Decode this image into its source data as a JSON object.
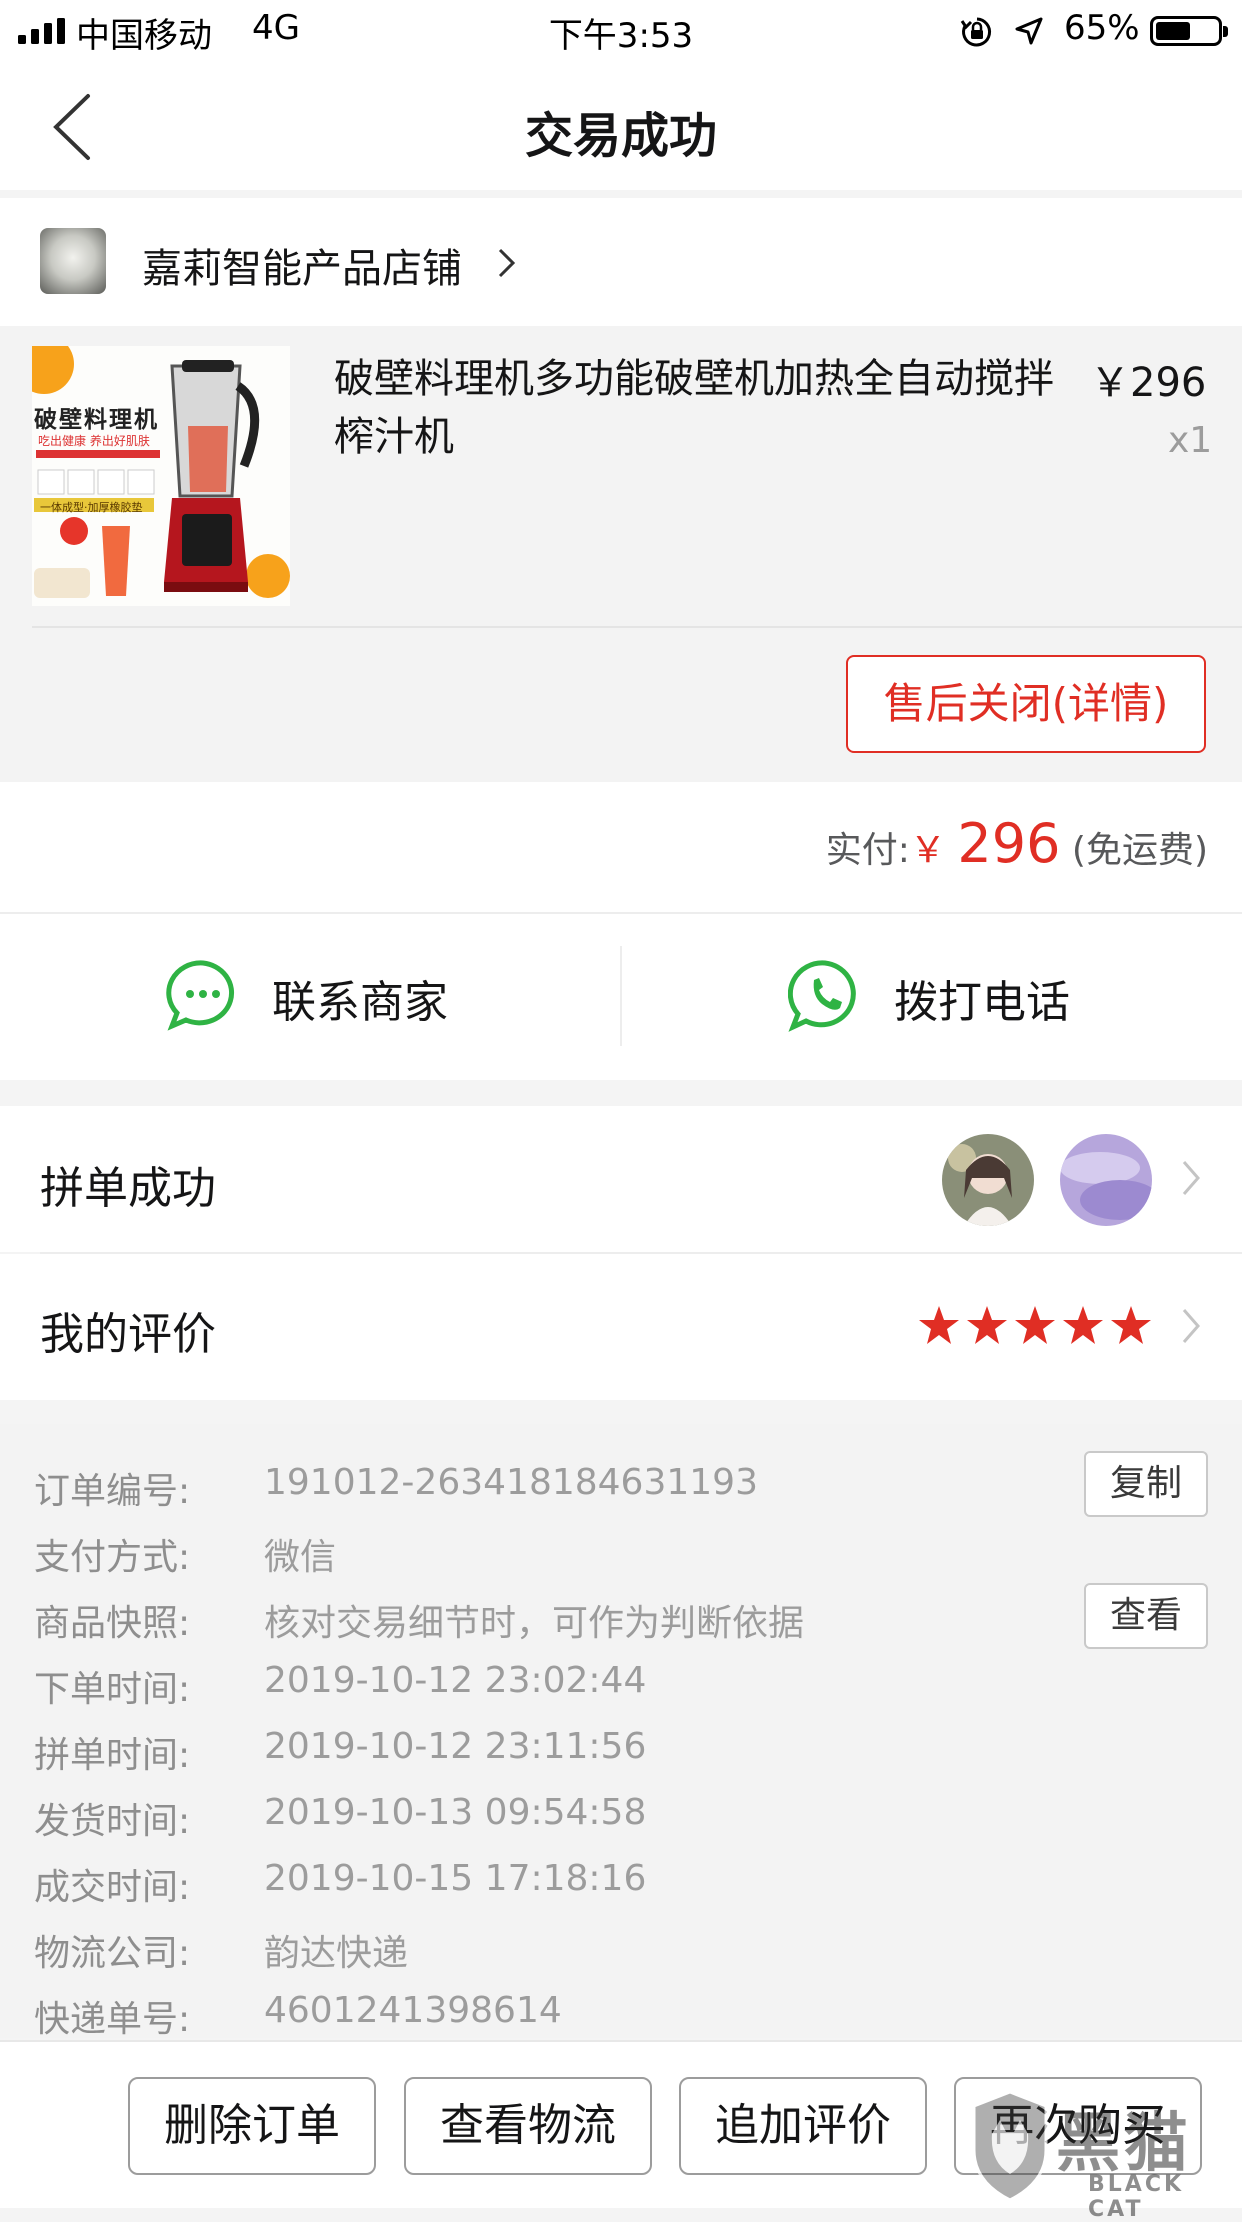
{
  "status_bar": {
    "carrier": "中国移动",
    "network": "4G",
    "time": "下午3:53",
    "battery": "65%"
  },
  "nav": {
    "title": "交易成功"
  },
  "store": {
    "name": "嘉莉智能产品店铺"
  },
  "product": {
    "image_text": "破壁料理机",
    "image_subtext": "吃出健康 养出好肌肤",
    "image_banner": "一体成型·加厚橡胶垫",
    "title": "破壁料理机多功能破壁机加热全自动搅拌榨汁机",
    "price": "￥296",
    "quantity": "x1",
    "after_sale_button": "售后关闭(详情)"
  },
  "payment": {
    "label": "实付:",
    "currency": "￥",
    "amount": "296",
    "note": "(免运费)"
  },
  "contact": {
    "merchant": "联系商家",
    "phone": "拨打电话"
  },
  "group_buy": {
    "label": "拼单成功"
  },
  "review": {
    "label": "我的评价",
    "rating": 5,
    "max_rating": 5
  },
  "details": {
    "order_no_label": "订单编号:",
    "order_no": "191012-263418184631193",
    "copy_button": "复制",
    "payment_method_label": "支付方式:",
    "payment_method": "微信",
    "snapshot_label": "商品快照:",
    "snapshot": "核对交易细节时，可作为判断依据",
    "view_button": "查看",
    "order_time_label": "下单时间:",
    "order_time": "2019-10-12 23:02:44",
    "group_time_label": "拼单时间:",
    "group_time": "2019-10-12 23:11:56",
    "ship_time_label": "发货时间:",
    "ship_time": "2019-10-13 09:54:58",
    "deal_time_label": "成交时间:",
    "deal_time": "2019-10-15 17:18:16",
    "courier_label": "物流公司:",
    "courier": "韵达快递",
    "tracking_label": "快递单号:",
    "tracking": "4601241398614"
  },
  "bottom_bar": {
    "delete": "删除订单",
    "logistics": "查看物流",
    "add_review": "追加评价",
    "rebuy": "再次购买"
  },
  "watermark": {
    "text": "黑猫",
    "subtext": "BLACK CAT"
  },
  "colors": {
    "accent": "#e02e24",
    "green": "#2fb344",
    "star": "#e02e24"
  }
}
